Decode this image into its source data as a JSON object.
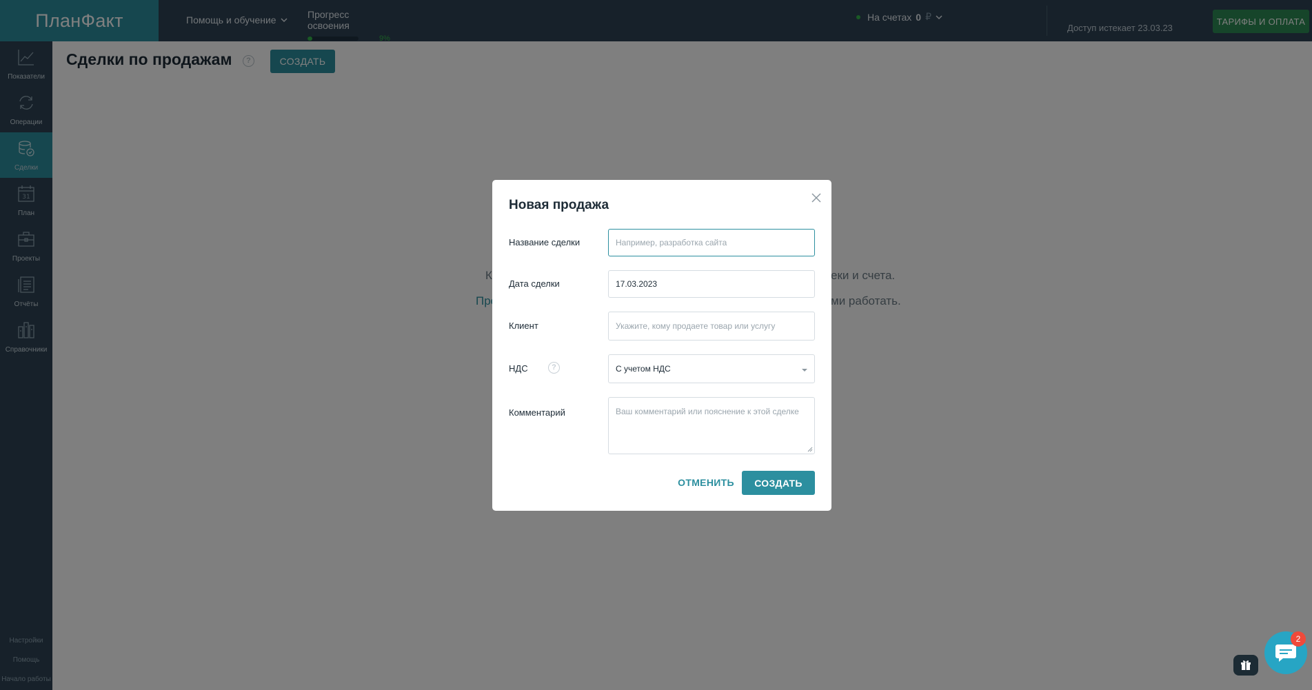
{
  "topbar": {
    "logo": "ПланФакт",
    "help_menu": "Помощь и обучение",
    "progress_label": "Прогресс освоения",
    "progress_value": 9,
    "progress_text": "9%",
    "accounts_label": "На счетах",
    "accounts_amount": "0",
    "accounts_currency": "₽",
    "access_text": "Доступ истекает 23.03.23",
    "tariffs_button": "ТАРИФЫ И ОПЛАТА"
  },
  "sidebar": {
    "items": [
      {
        "label": "Показатели",
        "icon": "chart-line-icon"
      },
      {
        "label": "Операции",
        "icon": "refresh-icon"
      },
      {
        "label": "Сделки",
        "icon": "deals-icon"
      },
      {
        "label": "План",
        "icon": "calendar-icon"
      },
      {
        "label": "Проекты",
        "icon": "briefcase-icon"
      },
      {
        "label": "Отчёты",
        "icon": "report-icon"
      },
      {
        "label": "Справочники",
        "icon": "directory-icon"
      }
    ],
    "bottom": {
      "settings": "Настройки",
      "help": "Помощь",
      "start": "Начало работы"
    }
  },
  "header": {
    "title": "Сделки по продажам",
    "create_button": "СОЗДАТЬ"
  },
  "background": {
    "line1_left": "К",
    "line1_right": "еки и счета.",
    "line2_left": "Про",
    "line2_right": "ми работать."
  },
  "modal": {
    "title": "Новая продажа",
    "fields": {
      "deal_name": {
        "label": "Название сделки",
        "placeholder": "Например, разработка сайта"
      },
      "deal_date": {
        "label": "Дата сделки",
        "value": "17.03.2023"
      },
      "client": {
        "label": "Клиент",
        "placeholder": "Укажите, кому продаете товар или услугу"
      },
      "nds": {
        "label": "НДС",
        "value": "С учетом НДС"
      },
      "comment": {
        "label": "Комментарий",
        "placeholder": "Ваш комментарий или пояснение к этой сделке"
      }
    },
    "cancel_button": "ОТМЕНИТЬ",
    "create_button": "СОЗДАТЬ"
  },
  "chat": {
    "badge": "2"
  },
  "colors": {
    "accent": "#2c8f9f",
    "sidebar": "#2e4354",
    "tariffs": "#2d8a55",
    "progress": "#34b24a",
    "chat": "#27a5c4",
    "badge": "#f04a3a"
  }
}
